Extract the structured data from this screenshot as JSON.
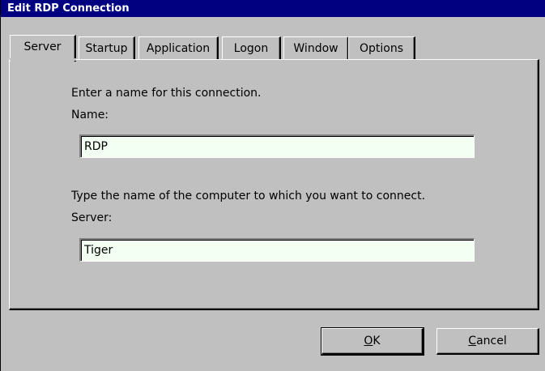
{
  "window": {
    "title": "Edit RDP Connection"
  },
  "tabs": [
    {
      "label": "Server",
      "active": true
    },
    {
      "label": "Startup",
      "active": false
    },
    {
      "label": "Application",
      "active": false
    },
    {
      "label": "Logon",
      "active": false
    },
    {
      "label": "Window",
      "active": false
    },
    {
      "label": "Options",
      "active": false
    }
  ],
  "server_tab": {
    "name_prompt": "Enter a name for this connection.",
    "name_label": "Name:",
    "name_value": "RDP",
    "server_prompt": "Type the name of the computer to which you want to connect.",
    "server_label": "Server:",
    "server_value": "Tiger"
  },
  "buttons": {
    "ok": {
      "mnemonic": "O",
      "rest": "K"
    },
    "cancel": {
      "mnemonic": "C",
      "rest": "ancel"
    }
  },
  "colors": {
    "titlebar": "#000080",
    "face": "#c0c0c0",
    "input_bg": "#f2fff2"
  }
}
